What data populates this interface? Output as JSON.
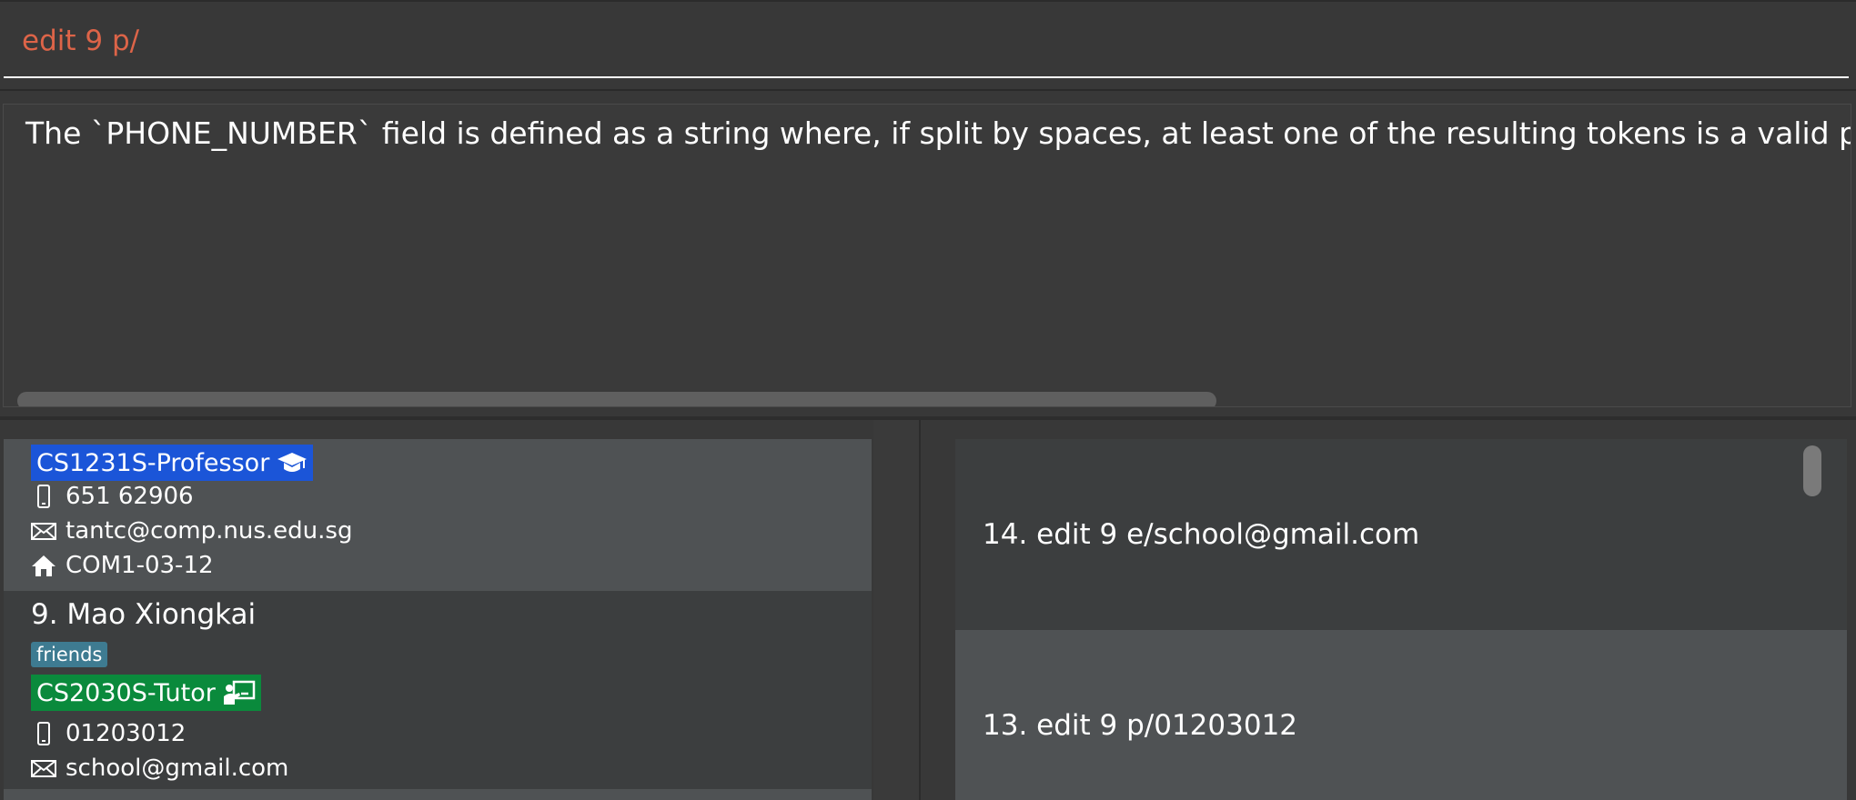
{
  "command_box": {
    "value": "edit 9 p/"
  },
  "result_display": {
    "text": "The `PHONE_NUMBER` field is defined as a string where, if split by spaces, at least one of the resulting tokens is a valid phone number, whi"
  },
  "person_list": {
    "card_a": {
      "role_tag": "CS1231S-Professor",
      "phone": "651 62906",
      "email": "tantc@comp.nus.edu.sg",
      "address": "COM1-03-12"
    },
    "card_b": {
      "name": "9. Mao Xiongkai",
      "tag": "friends",
      "role_tag": "CS2030S-Tutor",
      "phone": "01203012",
      "email": "school@gmail.com"
    }
  },
  "command_history": [
    {
      "label": "14. edit 9 e/school@gmail.com"
    },
    {
      "label": "13. edit 9 p/01203012"
    }
  ],
  "colors": {
    "command_text": "#dd6448",
    "professor_tag": "#1b55d8",
    "tutor_tag": "#0a8a3c",
    "friends_tag": "#3e7b91"
  },
  "icons": [
    "phone-icon",
    "mail-icon",
    "home-icon",
    "graduation-cap-icon",
    "teacher-board-icon"
  ]
}
